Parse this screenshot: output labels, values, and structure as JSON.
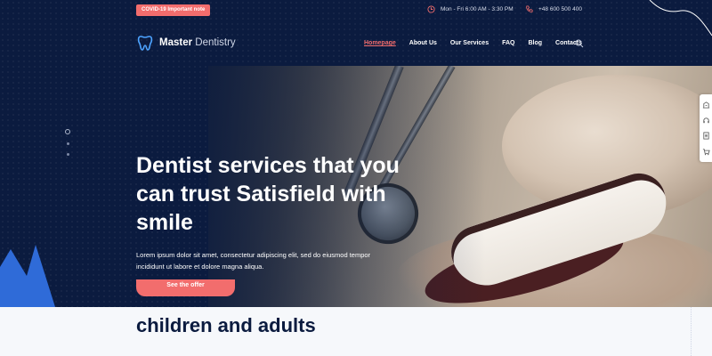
{
  "topbar": {
    "covid_note": "COVID-19 Important note",
    "hours": "Mon - Fri 6:00 AM - 3:30 PM",
    "phone": "+48 600 500 400",
    "hours_icon": "clock-icon",
    "phone_icon": "phone-icon"
  },
  "brand": {
    "name_bold": "Master",
    "name_light": "Dentistry",
    "logo_icon": "tooth-icon"
  },
  "nav": {
    "items": [
      "Homepage",
      "About Us",
      "Our Services",
      "FAQ",
      "Blog",
      "Contacts"
    ],
    "active_index": 0,
    "search_icon": "search-icon"
  },
  "hero": {
    "headline": "Dentist services that you can trust Satisfield with smile",
    "description": "Lorem ipsum dolor sit amet, consectetur adipiscing elit, sed do eiusmod tempor incididunt ut labore et dolore magna aliqua.",
    "cta_label": "See the offer",
    "slider_dots": 3,
    "active_dot": 0
  },
  "sidebar_icons": [
    "building-icon",
    "support-icon",
    "document-icon",
    "cart-icon"
  ],
  "section": {
    "heading": "children and adults"
  },
  "colors": {
    "navy": "#0b1b3f",
    "accent": "#f26d6d",
    "blue": "#2f6bd8"
  }
}
